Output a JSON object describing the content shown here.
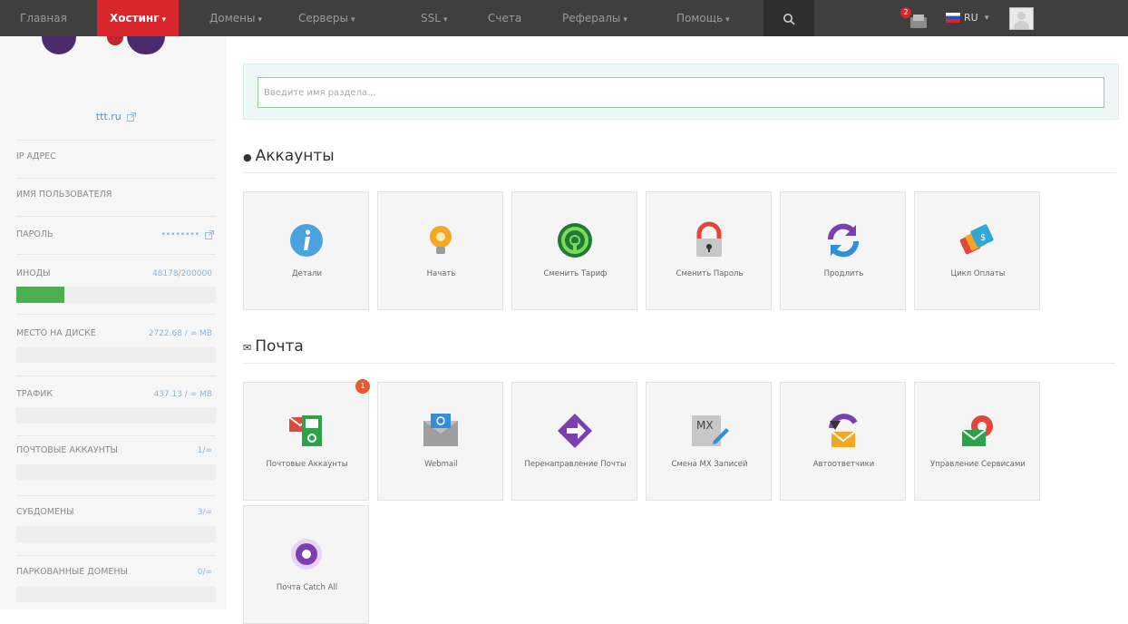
{
  "nav": {
    "items": [
      {
        "label": "Главная",
        "caret": ""
      },
      {
        "label": "Хостинг",
        "caret": "▾"
      },
      {
        "label": "Домены",
        "caret": "▾"
      },
      {
        "label": "Серверы",
        "caret": "▾"
      },
      {
        "label": "SSL",
        "caret": "▾"
      },
      {
        "label": "Счета",
        "caret": ""
      },
      {
        "label": "Рефералы",
        "caret": "▾"
      },
      {
        "label": "Помощь",
        "caret": "▾"
      }
    ],
    "search_icon": "🔍",
    "notification_count": "2",
    "language": "RU",
    "language_caret": "▾",
    "colors": {
      "bar": "#3f3f3f",
      "active": "#d9262c"
    }
  },
  "sidebar": {
    "domain": "ttt.ru",
    "domain_icon": "external-link-icon",
    "ip_label": "IP АДРЕС",
    "username_label": "ИМЯ ПОЛЬЗОВАТЕЛЯ",
    "password_label": "ПАРОЛЬ",
    "password_value": "••••••••",
    "inodes_label": "ИНОДЫ",
    "inodes_value": "48178/200000",
    "inodes_fraction": 0.24,
    "disk_label": "МЕСТО НА ДИСКЕ",
    "disk_value": "2722.68 / ∞ MB",
    "traffic_label": "ТРАФИК",
    "traffic_value": "437.13 / ∞ MB",
    "mail_label": "ПОЧТОВЫЕ АККАУНТЫ",
    "mail_value": "1/∞",
    "subdomains_label": "СУБДОМЕНЫ",
    "subdomains_value": "3/∞",
    "parked_label": "ПАРКОВАННЫЕ ДОМЕНЫ",
    "parked_value": "0/∞"
  },
  "search": {
    "placeholder": "Введите имя раздела..."
  },
  "sections": {
    "accounts": {
      "title": "Аккаунты",
      "tiles": [
        "Детали",
        "Начать",
        "Сменить Тариф",
        "Сменить Пароль",
        "Продлить",
        "Цикл Оплаты"
      ]
    },
    "mail": {
      "title": "Почта",
      "badge": "1",
      "tiles": [
        "Почтовые Аккаунты",
        "Webmail",
        "Перенаправление Почты",
        "Смена MX Записей",
        "Автоответчики",
        "Управление Сервисами",
        "Почта Catch All"
      ],
      "mx_text": "MX"
    }
  }
}
